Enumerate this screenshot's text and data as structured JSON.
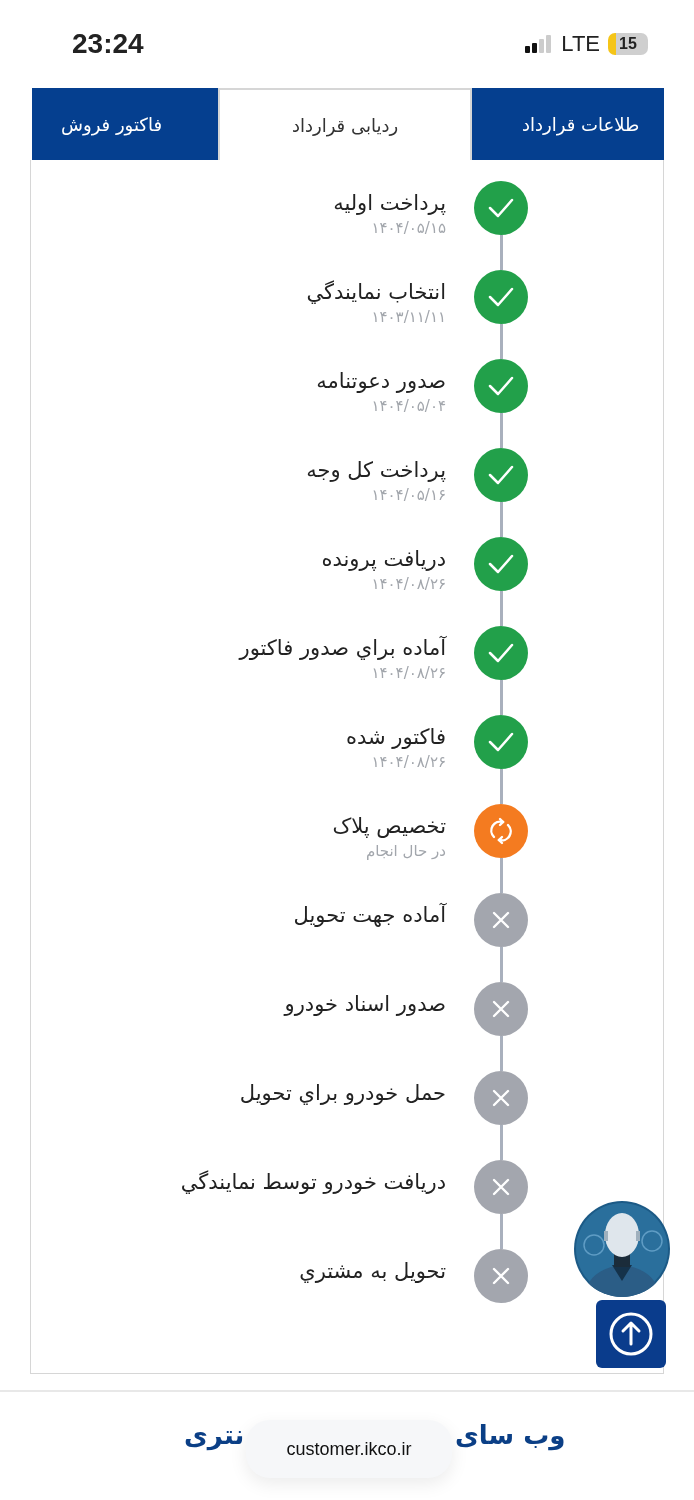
{
  "status_bar": {
    "time": "23:24",
    "network": "LTE",
    "battery": "15"
  },
  "tabs": [
    {
      "label": "طلاعات قرارداد",
      "selected": false
    },
    {
      "label": "ردیابی قرارداد",
      "selected": true
    },
    {
      "label": "فاکتور فروش",
      "selected": false
    }
  ],
  "steps": [
    {
      "title": "پرداخت اولیه",
      "subtitle": "۱۴۰۴/۰۵/۱۵",
      "kind": "done"
    },
    {
      "title": "انتخاب نمایندگي",
      "subtitle": "۱۴۰۳/۱۱/۱۱",
      "kind": "done"
    },
    {
      "title": "صدور دعوتنامه",
      "subtitle": "۱۴۰۴/۰۵/۰۴",
      "kind": "done"
    },
    {
      "title": "پرداخت کل وجه",
      "subtitle": "۱۴۰۴/۰۵/۱۶",
      "kind": "done"
    },
    {
      "title": "دریافت پرونده",
      "subtitle": "۱۴۰۴/۰۸/۲۶",
      "kind": "done"
    },
    {
      "title": "آماده براي صدور فاکتور",
      "subtitle": "۱۴۰۴/۰۸/۲۶",
      "kind": "done"
    },
    {
      "title": "فاکتور شده",
      "subtitle": "۱۴۰۴/۰۸/۲۶",
      "kind": "done"
    },
    {
      "title": "تخصیص پلاک",
      "subtitle": "در حال انجام",
      "kind": "in_progress"
    },
    {
      "title": "آماده جهت تحویل",
      "kind": "pending"
    },
    {
      "title": "صدور اسناد خودرو",
      "kind": "pending"
    },
    {
      "title": "حمل خودرو براي تحویل",
      "kind": "pending"
    },
    {
      "title": "دریافت خودرو توسط نمایندگي",
      "kind": "pending"
    },
    {
      "title": "تحویل به مشتري",
      "kind": "pending"
    }
  ],
  "footer": {
    "text_right": "وب سای",
    "text_left": "نتری",
    "url": "customer.ikco.ir"
  }
}
